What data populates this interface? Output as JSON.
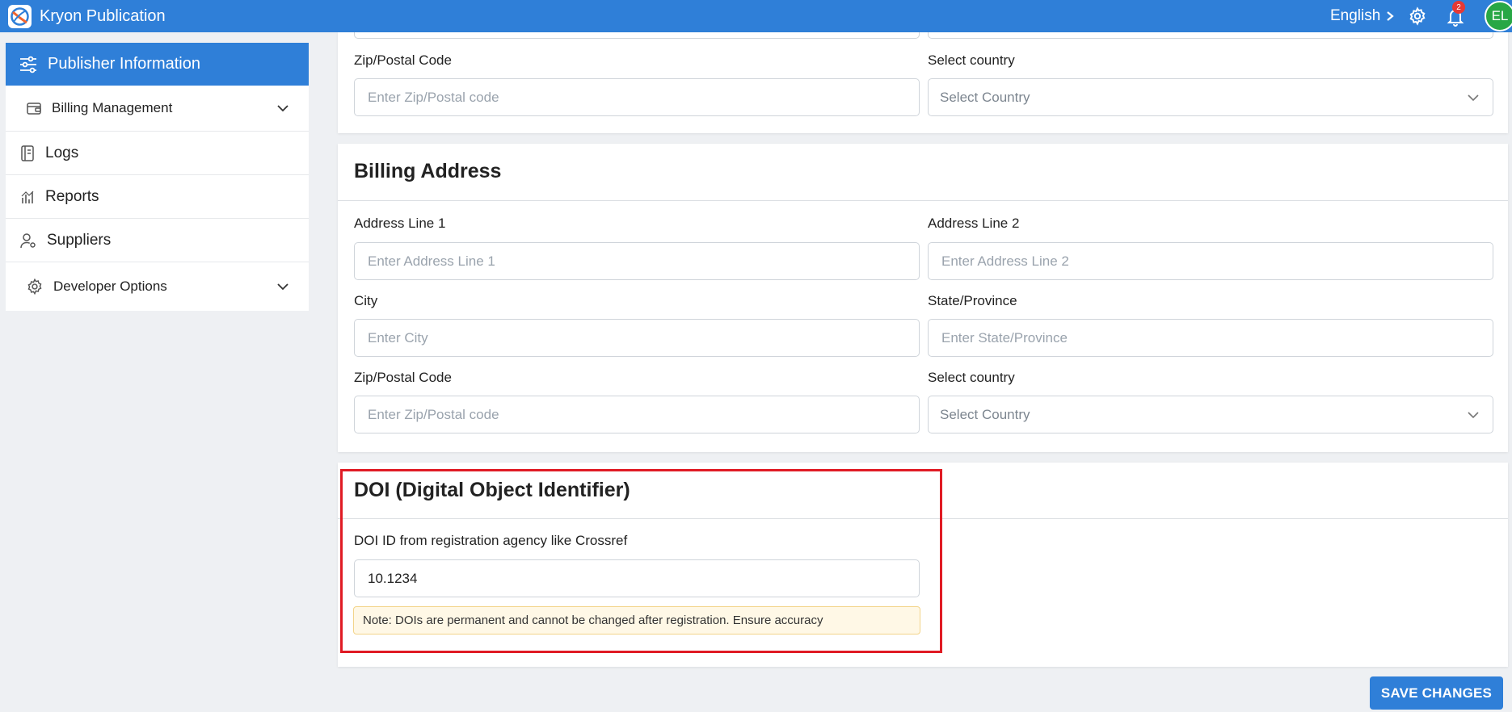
{
  "app": {
    "title": "Kryon Publication"
  },
  "topbar": {
    "language": "English",
    "notification_count": "2",
    "avatar_initials": "EL"
  },
  "sidebar": {
    "items": [
      {
        "label": "Publisher Information",
        "icon": "sliders-icon",
        "active": true
      },
      {
        "label": "Billing Management",
        "icon": "wallet-icon",
        "expandable": true
      },
      {
        "label": "Logs",
        "icon": "notebook-icon"
      },
      {
        "label": "Reports",
        "icon": "bar-chart-icon"
      },
      {
        "label": "Suppliers",
        "icon": "user-settings-icon"
      },
      {
        "label": "Developer Options",
        "icon": "gear-icon",
        "expandable": true
      }
    ]
  },
  "address_top": {
    "zip_label": "Zip/Postal Code",
    "zip_placeholder": "Enter Zip/Postal code",
    "country_label": "Select country",
    "country_value": "Select Country"
  },
  "billing": {
    "title": "Billing Address",
    "line1_label": "Address Line 1",
    "line1_placeholder": "Enter Address Line 1",
    "line2_label": "Address Line 2",
    "line2_placeholder": "Enter Address Line 2",
    "city_label": "City",
    "city_placeholder": "Enter City",
    "state_label": "State/Province",
    "state_placeholder": "Enter State/Province",
    "zip_label": "Zip/Postal Code",
    "zip_placeholder": "Enter Zip/Postal code",
    "country_label": "Select country",
    "country_value": "Select Country"
  },
  "doi": {
    "title": "DOI (Digital Object Identifier)",
    "label": "DOI ID from registration agency like Crossref",
    "value": "10.1234",
    "note": "Note: DOIs are permanent and cannot be changed after registration. Ensure accuracy"
  },
  "actions": {
    "save_label": "SAVE CHANGES"
  },
  "colors": {
    "primary": "#2f7fd8",
    "highlight": "#e01b24",
    "badge": "#e53935",
    "avatar": "#28a745",
    "note_bg": "#fff8e6"
  }
}
